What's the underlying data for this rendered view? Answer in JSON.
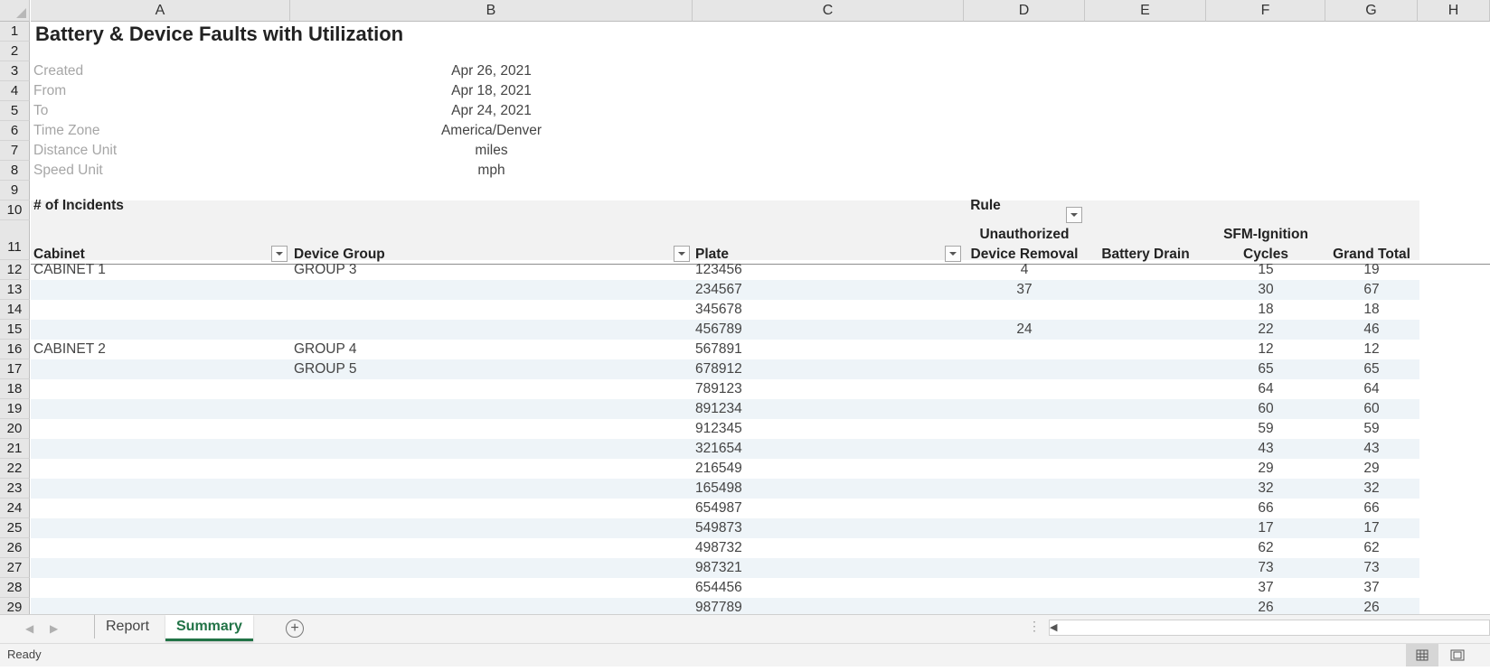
{
  "columns": [
    "A",
    "B",
    "C",
    "D",
    "E",
    "F",
    "G",
    "H"
  ],
  "row_numbers": [
    "1",
    "2",
    "3",
    "4",
    "5",
    "6",
    "7",
    "8",
    "9",
    "10",
    "11",
    "12",
    "13",
    "14",
    "15",
    "16",
    "17",
    "18",
    "19",
    "20",
    "21",
    "22",
    "23",
    "24",
    "25",
    "26",
    "27",
    "28",
    "29"
  ],
  "report": {
    "title": "Battery & Device Faults with Utilization",
    "meta": [
      {
        "label": "Created",
        "value": "Apr 26, 2021"
      },
      {
        "label": "From",
        "value": "Apr 18, 2021"
      },
      {
        "label": "To",
        "value": "Apr 24, 2021"
      },
      {
        "label": "Time Zone",
        "value": "America/Denver"
      },
      {
        "label": "Distance Unit",
        "value": "miles"
      },
      {
        "label": "Speed Unit",
        "value": "mph"
      }
    ]
  },
  "pivot": {
    "value_label": "# of Incidents",
    "column_field": "Rule",
    "row_fields": [
      "Cabinet",
      "Device Group",
      "Plate"
    ],
    "rule_headers": [
      {
        "line1": "Unauthorized",
        "line2": "Device Removal"
      },
      {
        "line1": "",
        "line2": "Battery Drain"
      },
      {
        "line1": "SFM-Ignition",
        "line2": "Cycles"
      }
    ],
    "grand_total_label": "Grand Total",
    "rows": [
      {
        "cabinet": "CABINET 1",
        "group": "GROUP 3",
        "plate": "123456",
        "unauth": "4",
        "battery": "",
        "sfm": "15",
        "total": "19"
      },
      {
        "cabinet": "",
        "group": "",
        "plate": "234567",
        "unauth": "37",
        "battery": "",
        "sfm": "30",
        "total": "67"
      },
      {
        "cabinet": "",
        "group": "",
        "plate": "345678",
        "unauth": "",
        "battery": "",
        "sfm": "18",
        "total": "18"
      },
      {
        "cabinet": "",
        "group": "",
        "plate": "456789",
        "unauth": "24",
        "battery": "",
        "sfm": "22",
        "total": "46"
      },
      {
        "cabinet": "CABINET 2",
        "group": "GROUP 4",
        "plate": "567891",
        "unauth": "",
        "battery": "",
        "sfm": "12",
        "total": "12"
      },
      {
        "cabinet": "",
        "group": "GROUP 5",
        "plate": "678912",
        "unauth": "",
        "battery": "",
        "sfm": "65",
        "total": "65"
      },
      {
        "cabinet": "",
        "group": "",
        "plate": "789123",
        "unauth": "",
        "battery": "",
        "sfm": "64",
        "total": "64"
      },
      {
        "cabinet": "",
        "group": "",
        "plate": "891234",
        "unauth": "",
        "battery": "",
        "sfm": "60",
        "total": "60"
      },
      {
        "cabinet": "",
        "group": "",
        "plate": "912345",
        "unauth": "",
        "battery": "",
        "sfm": "59",
        "total": "59"
      },
      {
        "cabinet": "",
        "group": "",
        "plate": "321654",
        "unauth": "",
        "battery": "",
        "sfm": "43",
        "total": "43"
      },
      {
        "cabinet": "",
        "group": "",
        "plate": "216549",
        "unauth": "",
        "battery": "",
        "sfm": "29",
        "total": "29"
      },
      {
        "cabinet": "",
        "group": "",
        "plate": "165498",
        "unauth": "",
        "battery": "",
        "sfm": "32",
        "total": "32"
      },
      {
        "cabinet": "",
        "group": "",
        "plate": "654987",
        "unauth": "",
        "battery": "",
        "sfm": "66",
        "total": "66"
      },
      {
        "cabinet": "",
        "group": "",
        "plate": "549873",
        "unauth": "",
        "battery": "",
        "sfm": "17",
        "total": "17"
      },
      {
        "cabinet": "",
        "group": "",
        "plate": "498732",
        "unauth": "",
        "battery": "",
        "sfm": "62",
        "total": "62"
      },
      {
        "cabinet": "",
        "group": "",
        "plate": "987321",
        "unauth": "",
        "battery": "",
        "sfm": "73",
        "total": "73"
      },
      {
        "cabinet": "",
        "group": "",
        "plate": "654456",
        "unauth": "",
        "battery": "",
        "sfm": "37",
        "total": "37"
      },
      {
        "cabinet": "",
        "group": "",
        "plate": "987789",
        "unauth": "",
        "battery": "",
        "sfm": "26",
        "total": "26"
      }
    ]
  },
  "sheet_tabs": [
    {
      "label": "Report",
      "active": false
    },
    {
      "label": "Summary",
      "active": true
    }
  ],
  "status": {
    "text": "Ready"
  },
  "icons": [
    "sheet-prev-icon",
    "sheet-next-icon",
    "add-sheet-icon",
    "scroll-left-icon",
    "normal-view-icon",
    "page-layout-view-icon",
    "filter-dropdown-icon"
  ],
  "colors": {
    "accent": "#217346",
    "band": "#eef4f8",
    "header_fill": "#f2f2f2",
    "gray_label": "#a6a6a6"
  }
}
